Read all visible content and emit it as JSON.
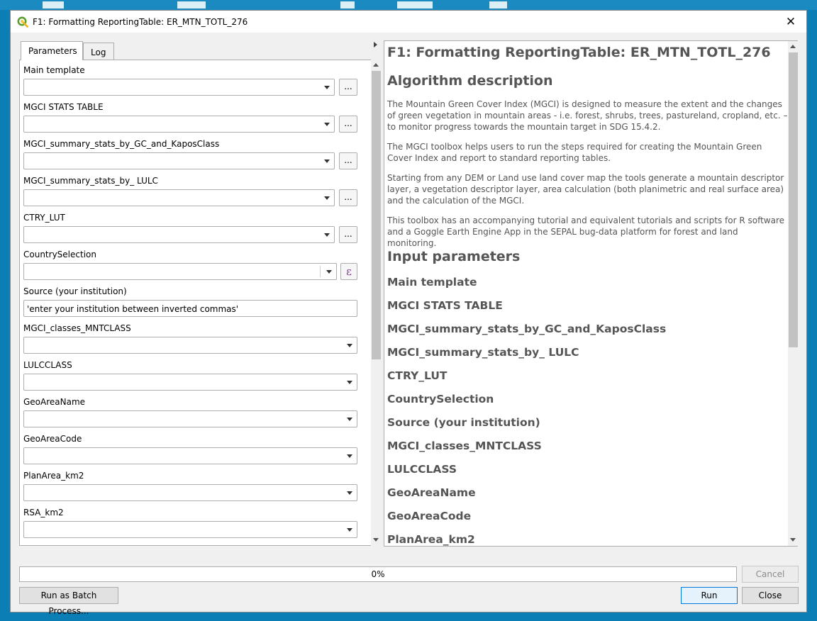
{
  "window": {
    "title": "F1: Formatting ReportingTable: ER_MTN_TOTL_276",
    "close_glyph": "✕"
  },
  "tabs": [
    {
      "label": "Parameters",
      "active": true
    },
    {
      "label": "Log",
      "active": false
    }
  ],
  "parameters": [
    {
      "label": "Main template",
      "widget": "combo-browse",
      "value": ""
    },
    {
      "label": "MGCI STATS TABLE",
      "widget": "combo-browse",
      "value": ""
    },
    {
      "label": "MGCI_summary_stats_by_GC_and_KaposClass",
      "widget": "combo-browse",
      "value": ""
    },
    {
      "label": "MGCI_summary_stats_by_ LULC",
      "widget": "combo-browse",
      "value": ""
    },
    {
      "label": "CTRY_LUT",
      "widget": "combo-browse",
      "value": ""
    },
    {
      "label": "CountrySelection",
      "widget": "combo-expression",
      "value": ""
    },
    {
      "label": "Source (your institution)",
      "widget": "text",
      "value": "'enter your institution between inverted commas'"
    },
    {
      "label": "MGCI_classes_MNTCLASS",
      "widget": "combo",
      "value": ""
    },
    {
      "label": "LULCCLASS",
      "widget": "combo",
      "value": ""
    },
    {
      "label": "GeoAreaName",
      "widget": "combo",
      "value": ""
    },
    {
      "label": "GeoAreaCode",
      "widget": "combo",
      "value": ""
    },
    {
      "label": "PlanArea_km2",
      "widget": "combo",
      "value": ""
    },
    {
      "label": "RSA_km2",
      "widget": "combo",
      "value": ""
    }
  ],
  "browse_label": "...",
  "expression_glyph": "ε",
  "help": {
    "title": "F1: Formatting ReportingTable: ER_MTN_TOTL_276",
    "algo_heading": "Algorithm description",
    "paragraphs": [
      "The Mountain Green Cover Index (MGCI) is designed to measure the extent and the changes of green vegetation in mountain areas - i.e. forest, shrubs, trees, pastureland, cropland, etc. – to monitor progress towards the mountain target in SDG 15.4.2.",
      "The MGCI toolbox helps users to run the steps required for creating the Mountain Green Cover Index and report to standard reporting tables.",
      "Starting from any DEM or Land use land cover map the tools generate a mountain descriptor layer, a vegetation descriptor layer, area calculation (both planimetric and real surface area) and the calculation of the MGCI.",
      "This toolbox has an accompanying tutorial and equivalent tutorials and scripts for R software and a Goggle Earth Engine App in the SEPAL bug-data platform for forest and land monitoring."
    ],
    "input_heading": "Input parameters",
    "input_params": [
      "Main template",
      "MGCI STATS TABLE",
      "MGCI_summary_stats_by_GC_and_KaposClass",
      "MGCI_summary_stats_by_ LULC",
      "CTRY_LUT",
      "CountrySelection",
      "Source (your institution)",
      "MGCI_classes_MNTCLASS",
      "LULCCLASS",
      "GeoAreaName",
      "GeoAreaCode",
      "PlanArea_km2"
    ]
  },
  "progress": {
    "text": "0%",
    "value": 0
  },
  "buttons": {
    "cancel": "Cancel",
    "batch": "Run as Batch Process...",
    "run": "Run",
    "close": "Close"
  },
  "colors": {
    "desktop": "#0b7fb5",
    "accent": "#0078d7",
    "help_text": "#555555",
    "expression": "#7a3b8c"
  }
}
